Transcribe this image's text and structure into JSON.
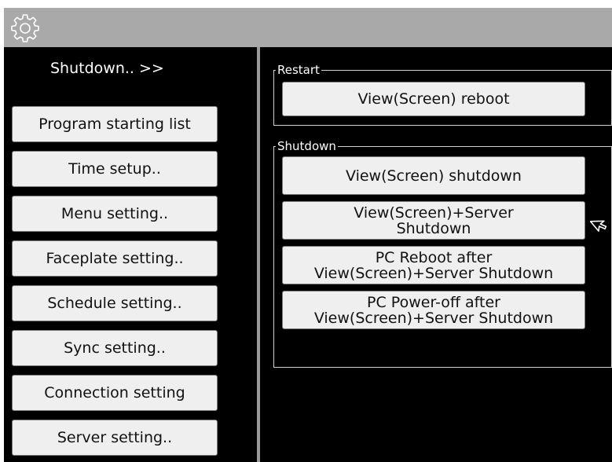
{
  "window": {
    "icons": {
      "settings": "gear-icon",
      "pointer": "mouse-cursor-arrow"
    },
    "colors": {
      "titlebar": "#a9a9a9",
      "background": "#000000",
      "button": "#efefef",
      "divider": "#9a9a9a"
    }
  },
  "sidebar": {
    "breadcrumb": "Shutdown.. >>",
    "items": [
      {
        "label": "Program starting list"
      },
      {
        "label": "Time setup.."
      },
      {
        "label": "Menu setting.."
      },
      {
        "label": "Faceplate setting.."
      },
      {
        "label": "Schedule setting.."
      },
      {
        "label": "Sync setting.."
      },
      {
        "label": "Connection setting"
      },
      {
        "label": "Server setting.."
      }
    ]
  },
  "restart": {
    "title": "Restart",
    "buttons": [
      {
        "lines": [
          "View(Screen) reboot"
        ]
      }
    ]
  },
  "shutdown": {
    "title": "Shutdown",
    "buttons": [
      {
        "lines": [
          "View(Screen) shutdown"
        ]
      },
      {
        "lines": [
          "View(Screen)+Server",
          "Shutdown"
        ]
      },
      {
        "lines": [
          "PC Reboot after",
          "View(Screen)+Server Shutdown"
        ]
      },
      {
        "lines": [
          "PC Power-off after",
          "View(Screen)+Server Shutdown"
        ]
      }
    ]
  }
}
